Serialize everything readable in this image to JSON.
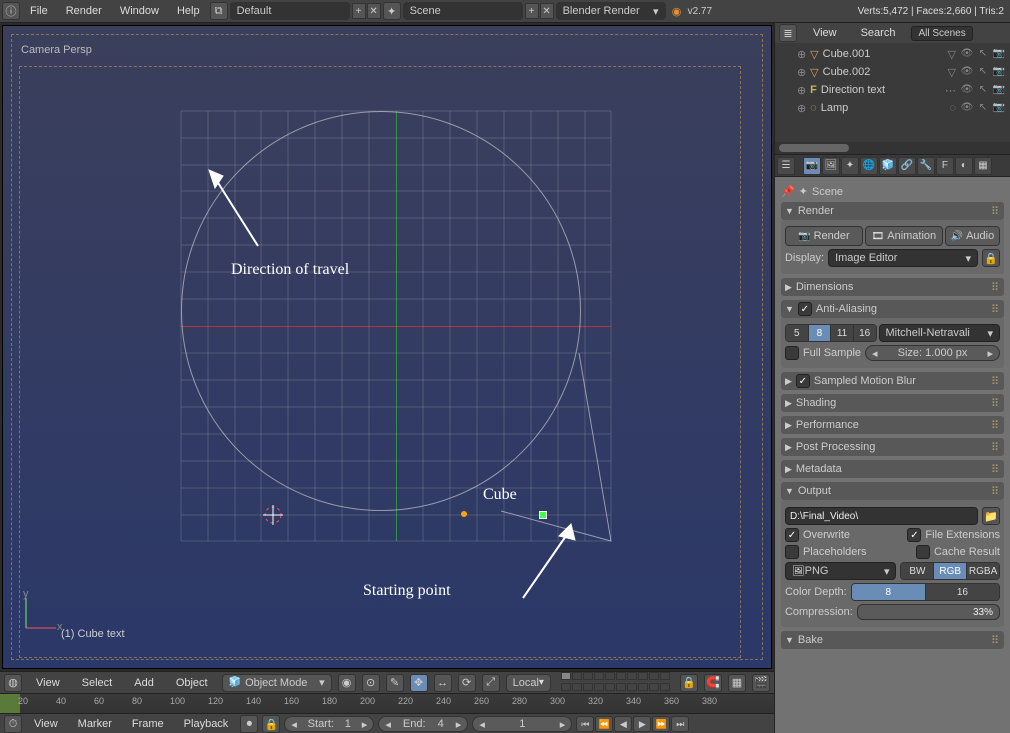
{
  "topbar": {
    "menus": [
      "File",
      "Render",
      "Window",
      "Help"
    ],
    "layout": "Default",
    "scene": "Scene",
    "engine": "Blender Render",
    "version": "v2.77",
    "stats": "Verts:5,472 | Faces:2,660 | Tris:2"
  },
  "viewport": {
    "view_label": "Camera Persp",
    "object_label": "(1) Cube text",
    "annot_direction": "Direction of travel",
    "annot_start": "Starting point",
    "annot_cube": "Cube"
  },
  "vpheader": {
    "menus": [
      "View",
      "Select",
      "Add",
      "Object"
    ],
    "mode": "Object Mode",
    "orient": "Local"
  },
  "timeline": {
    "ticks": [
      "20",
      "40",
      "60",
      "80",
      "100",
      "120",
      "140",
      "160",
      "180",
      "200",
      "220",
      "240",
      "260",
      "280",
      "300",
      "320",
      "340",
      "360",
      "380"
    ],
    "menus": [
      "View",
      "Marker",
      "Frame",
      "Playback"
    ],
    "start_label": "Start:",
    "start_val": "1",
    "end_label": "End:",
    "end_val": "4",
    "cur_val": "1"
  },
  "outliner": {
    "menus": [
      "View",
      "Search"
    ],
    "filter": "All Scenes",
    "items": [
      {
        "name": "Cube.001",
        "icon": "▽",
        "color": "#e0a060"
      },
      {
        "name": "Cube.002",
        "icon": "▽",
        "color": "#e0a060"
      },
      {
        "name": "Direction text",
        "icon": "F",
        "color": "#d0b060"
      },
      {
        "name": "Lamp",
        "icon": "◌",
        "color": "#d0c050"
      }
    ]
  },
  "props": {
    "scene_label": "Scene",
    "render_btn": "Render",
    "anim_btn": "Animation",
    "audio_btn": "Audio",
    "display_label": "Display:",
    "display_value": "Image Editor",
    "panels": {
      "render": "Render",
      "dimensions": "Dimensions",
      "aa": "Anti-Aliasing",
      "smb": "Sampled Motion Blur",
      "shading": "Shading",
      "performance": "Performance",
      "postproc": "Post Processing",
      "metadata": "Metadata",
      "output": "Output",
      "bake": "Bake"
    },
    "aa": {
      "samples": [
        "5",
        "8",
        "11",
        "16"
      ],
      "filter": "Mitchell-Netravali",
      "full_sample": "Full Sample",
      "size_label": "Size:",
      "size_val": "1.000 px"
    },
    "output": {
      "path": "D:\\Final_Video\\",
      "overwrite": "Overwrite",
      "file_ext": "File Extensions",
      "placeholders": "Placeholders",
      "cache_result": "Cache Result",
      "format": "PNG",
      "bw": "BW",
      "rgb": "RGB",
      "rgba": "RGBA",
      "depth_label": "Color Depth:",
      "d8": "8",
      "d16": "16",
      "comp_label": "Compression:",
      "comp_val": "33%"
    }
  }
}
